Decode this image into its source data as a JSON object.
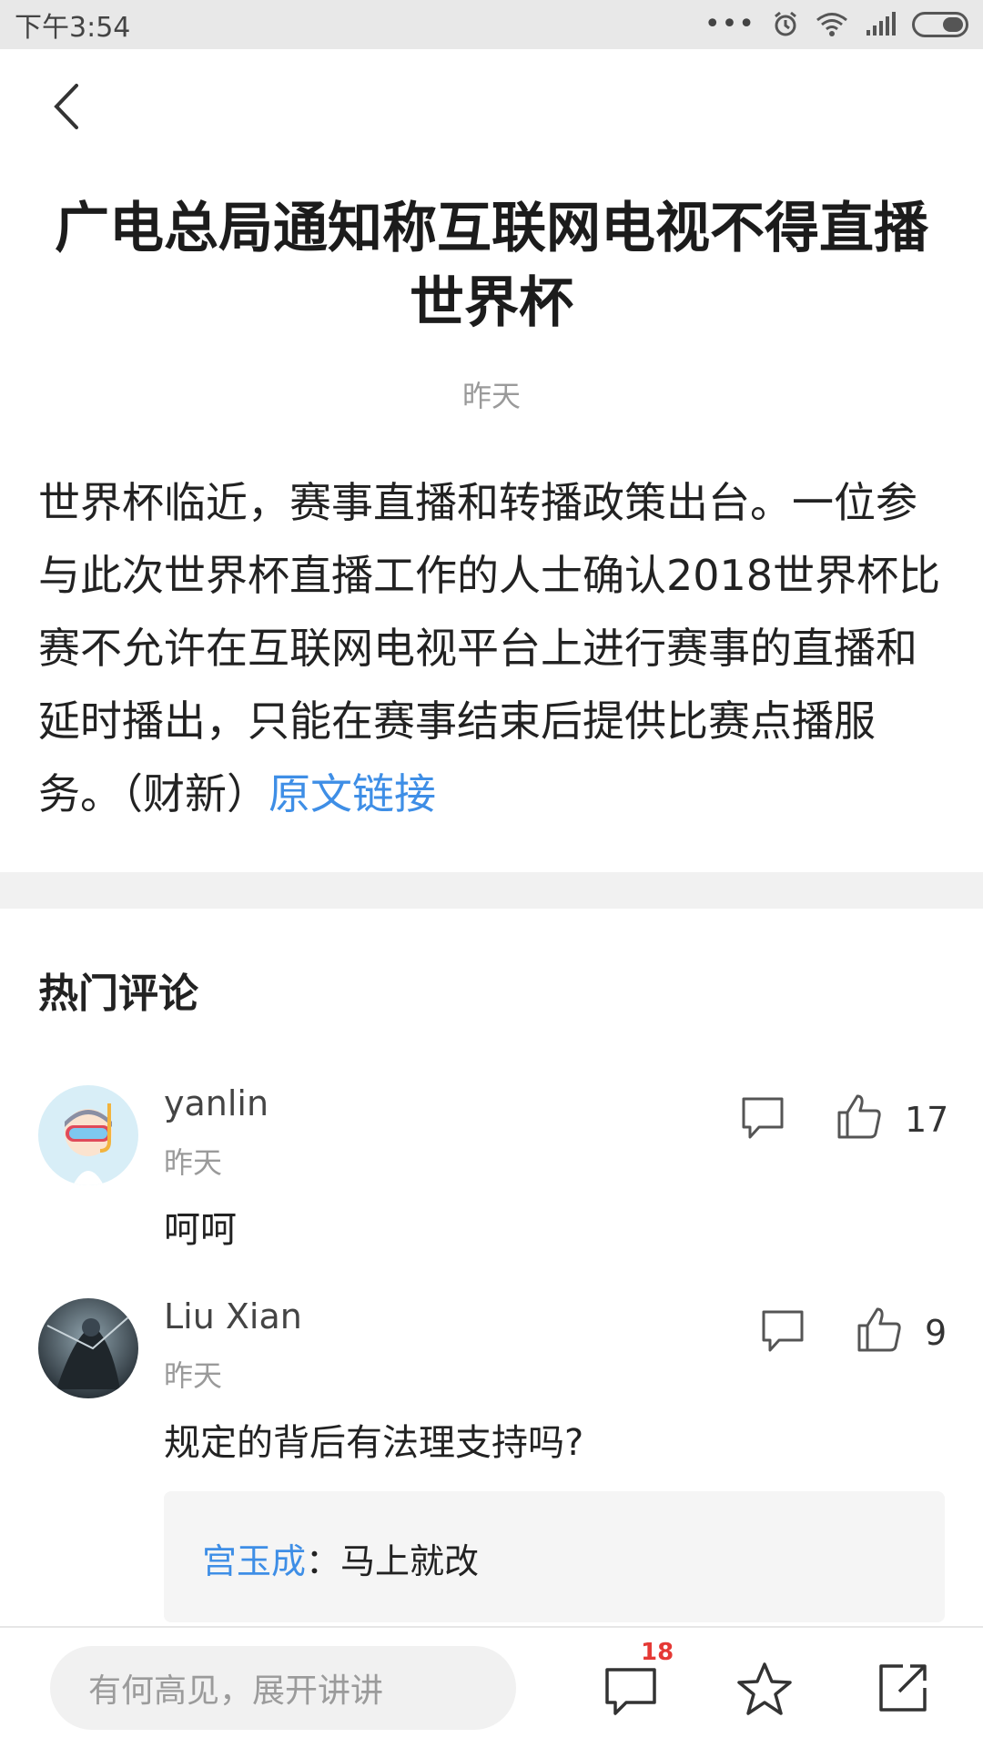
{
  "status_bar": {
    "time": "下午3:54",
    "dots": "•••"
  },
  "article": {
    "title": "广电总局通知称互联网电视不得直播世界杯",
    "date": "昨天",
    "body": "世界杯临近，赛事直播和转播政策出台。一位参与此次世界杯直播工作的人士确认2018世界杯比赛不允许在互联网电视平台上进行赛事的直播和延时播出，只能在赛事结束后提供比赛点播服务。（财新）",
    "link_text": "原文链接"
  },
  "comments_section": {
    "title": "热门评论",
    "items": [
      {
        "name": "yanlin",
        "time": "昨天",
        "text": "呵呵",
        "likes": "17"
      },
      {
        "name": "Liu Xian",
        "time": "昨天",
        "text": "规定的背后有法理支持吗?",
        "likes": "9",
        "reply": {
          "author": "宫玉成",
          "separator": "：",
          "text": "马上就改"
        }
      }
    ]
  },
  "bottom_bar": {
    "input_placeholder": "有何高见，展开讲讲",
    "comment_count": "18"
  },
  "icons": [
    "back-icon",
    "alarm-icon",
    "wifi-icon",
    "signal-icon",
    "battery-icon",
    "comment-icon",
    "like-icon",
    "star-icon",
    "share-icon"
  ],
  "colors": {
    "link": "#3e8ee6",
    "badge": "#e53935",
    "status_bar_bg": "#e8e8e8"
  }
}
